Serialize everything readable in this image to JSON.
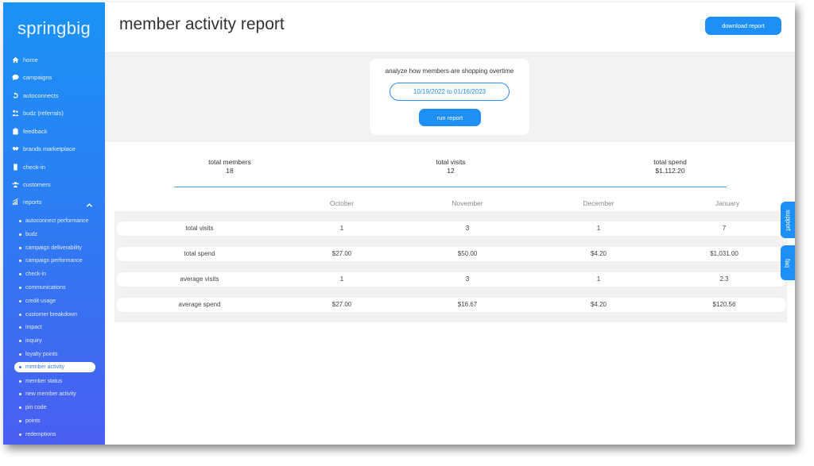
{
  "app": {
    "logo": "springbig"
  },
  "sidebar": {
    "items": [
      {
        "label": "home",
        "icon": "home-icon"
      },
      {
        "label": "campaigns",
        "icon": "chat-bubble-icon"
      },
      {
        "label": "autoconnects",
        "icon": "refresh-icon"
      },
      {
        "label": "budz (referrals)",
        "icon": "people-icon"
      },
      {
        "label": "feedback",
        "icon": "clipboard-icon"
      },
      {
        "label": "brands marketplace",
        "icon": "handshake-icon"
      },
      {
        "label": "check-in",
        "icon": "door-icon"
      },
      {
        "label": "customers",
        "icon": "users-icon"
      },
      {
        "label": "reports",
        "icon": "chart-icon"
      }
    ],
    "reports_sub": [
      "autoconnect performance",
      "budz",
      "campaign deliverability",
      "campaign performance",
      "check-in",
      "communications",
      "credit usage",
      "customer breakdown",
      "impact",
      "inquiry",
      "loyalty points",
      "member activity",
      "member status",
      "new member activity",
      "pin code",
      "points",
      "redemptions"
    ],
    "active_sub": "member activity"
  },
  "header": {
    "title": "member activity report",
    "download_label": "download report"
  },
  "filter": {
    "title": "analyze how members are shopping overtime",
    "date_range": "10/19/2022 to 01/16/2023",
    "run_label": "run report"
  },
  "summary": {
    "members_label": "total members",
    "members_value": "18",
    "visits_label": "total visits",
    "visits_value": "12",
    "spend_label": "total spend",
    "spend_value": "$1,112.20"
  },
  "table": {
    "months": [
      "October",
      "November",
      "December",
      "January"
    ],
    "rows": [
      {
        "label": "total visits",
        "values": [
          "1",
          "3",
          "1",
          "7"
        ]
      },
      {
        "label": "total spend",
        "values": [
          "$27.00",
          "$50.00",
          "$4.20",
          "$1,031.00"
        ]
      },
      {
        "label": "average visits",
        "values": [
          "1",
          "3",
          "1",
          "2.3"
        ]
      },
      {
        "label": "average spend",
        "values": [
          "$27.00",
          "$16.67",
          "$4.20",
          "$120.56"
        ]
      }
    ]
  },
  "side_tabs": {
    "support": "support",
    "faq": "faq"
  },
  "colors": {
    "accent": "#1e90f5",
    "sidebar_top": "#1a93f5",
    "sidebar_bottom": "#4a5ef0"
  }
}
